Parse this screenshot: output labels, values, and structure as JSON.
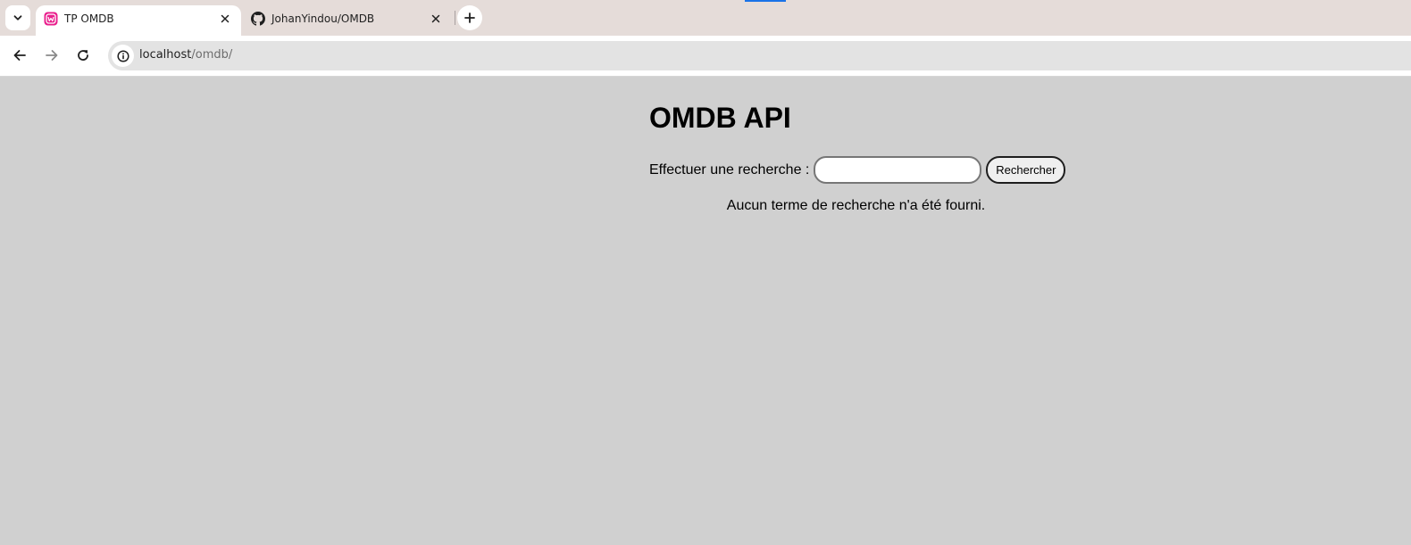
{
  "browser": {
    "tabs": [
      {
        "title": "TP OMDB",
        "favicon": "wamp-icon",
        "active": true
      },
      {
        "title": "JohanYindou/OMDB",
        "favicon": "github-icon",
        "active": false
      }
    ],
    "address_bar": {
      "host": "localhost",
      "path": "/omdb/"
    },
    "colors": {
      "tabstrip": "#e5dcd9",
      "accent": "#1a73e8",
      "favicon_pink": "#e91e8c"
    }
  },
  "page": {
    "title": "OMDB API",
    "search": {
      "label": "Effectuer une recherche :",
      "value": "",
      "button_label": "Rechercher"
    },
    "message": "Aucun terme de recherche n'a été fourni.",
    "background": "#d0d0d0"
  }
}
